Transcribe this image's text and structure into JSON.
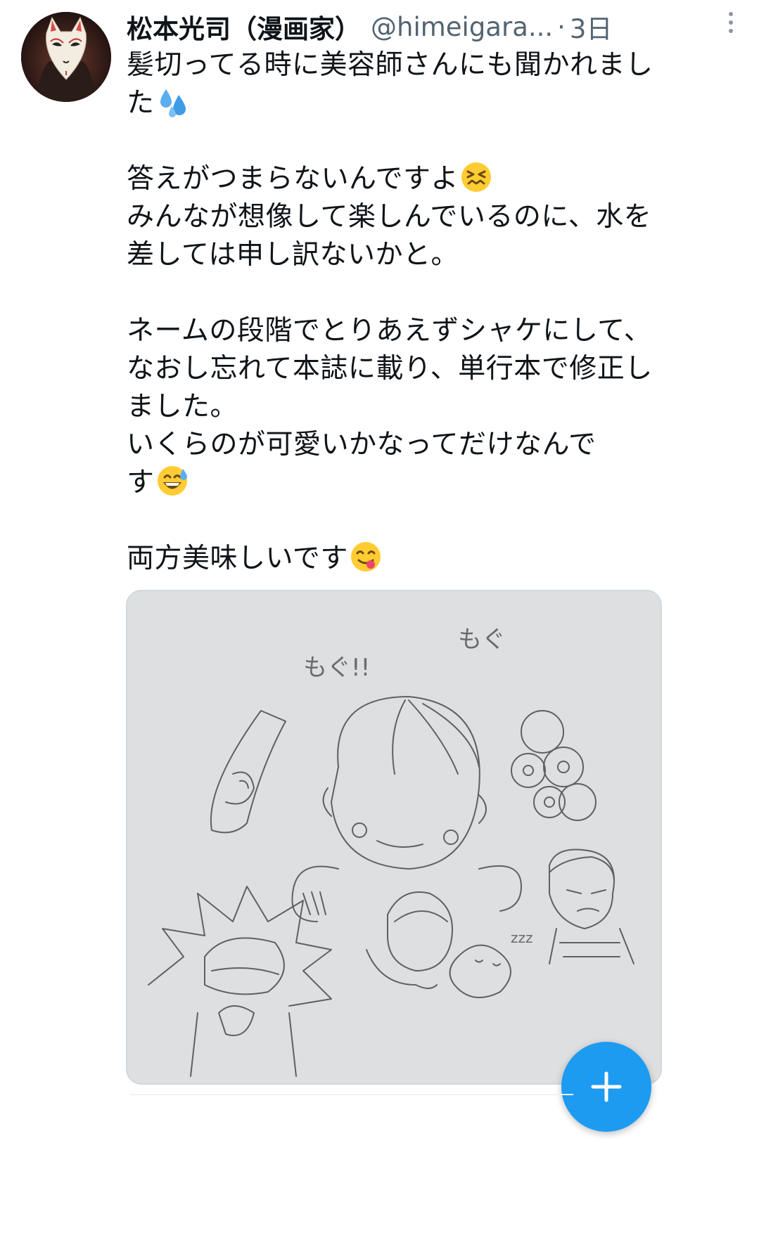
{
  "tweet": {
    "display_name": "松本光司（漫画家）",
    "handle": "@himeigara...",
    "separator": "·",
    "time": "3日",
    "avatar_icon": "fox-mask-avatar",
    "more_icon": "more-vertical-icon",
    "lines": [
      "髪切ってる時に美容師さんにも聞かれまし",
      "た",
      "",
      "答えがつまらないんですよ",
      "みんなが想像して楽しんでいるのに、水を",
      "差しては申し訳ないかと。",
      "",
      "ネームの段階でとりあえずシャケにして、",
      "なおし忘れて本誌に載り、単行本で修正し",
      "ました。",
      "いくらのが可愛いかなってだけなんで",
      "す",
      "",
      "両方美味しいです"
    ],
    "emojis": {
      "sweat_droplets": "sweat-droplets-emoji",
      "confounded": "confounded-face-emoji",
      "grinning_sweat": "grinning-sweat-emoji",
      "yum": "savoring-food-face-emoji"
    }
  },
  "media": {
    "sketch_text_1": "もぐ!!",
    "sketch_text_2": "もぐ",
    "sketch_text_3": "zzz"
  },
  "fab": {
    "icon": "plus-icon",
    "color": "#1d9bf0"
  },
  "colors": {
    "name": "#0f1419",
    "secondary": "#536471",
    "accent": "#1d9bf0"
  }
}
